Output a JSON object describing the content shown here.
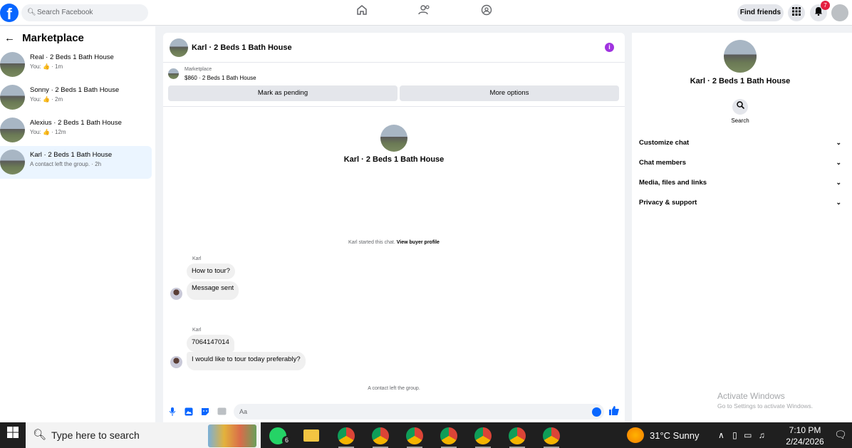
{
  "topbar": {
    "logo": "f",
    "search_placeholder": "Search Facebook",
    "find_friends": "Find friends",
    "notification_count": "7",
    "icons": [
      "home-icon",
      "friends-icon",
      "groups-icon",
      "menu-grid-icon",
      "bell-icon"
    ]
  },
  "marketplace": {
    "title": "Marketplace",
    "back_icon": "←",
    "threads": [
      {
        "title": "Real · 2 Beds 1 Bath House",
        "sub": "You: 👍 · 1m"
      },
      {
        "title": "Sonny · 2 Beds 1 Bath House",
        "sub": "You: 👍 · 2m"
      },
      {
        "title": "Alexius · 2 Beds 1 Bath House",
        "sub": "You: 👍 · 12m"
      },
      {
        "title": "Karl · 2 Beds 1 Bath House",
        "sub": "A contact left the group. · 2h"
      }
    ]
  },
  "chat": {
    "header_title": "Karl · 2 Beds 1 Bath House",
    "info_icon": "i",
    "listing_label": "Marketplace",
    "listing_price": "$860 · 2 Beds 1 Bath House",
    "mark_pending": "Mark as pending",
    "more_options": "More options",
    "intro_title": "Karl · 2 Beds 1 Bath House",
    "started_text": "Karl started this chat.",
    "view_profile": "View buyer profile",
    "groups": [
      {
        "sender": "Karl",
        "messages": [
          "How to tour?",
          "Message sent"
        ]
      },
      {
        "sender": "Karl",
        "messages": [
          "7064147014",
          "I would like to tour today preferably?"
        ]
      }
    ],
    "left_note": "A contact left the group.",
    "composer_placeholder": "Aa"
  },
  "details": {
    "title": "Karl · 2 Beds 1 Bath House",
    "search_label": "Search",
    "sections": [
      "Customize chat",
      "Chat members",
      "Media, files and links",
      "Privacy & support"
    ],
    "activate_title": "Activate Windows",
    "activate_sub": "Go to Settings to activate Windows."
  },
  "taskbar": {
    "search_placeholder": "Type here to search",
    "whatsapp_badge": "6",
    "weather": "31°C  Sunny",
    "time": "7:10 PM",
    "date": "2/24/2026"
  }
}
